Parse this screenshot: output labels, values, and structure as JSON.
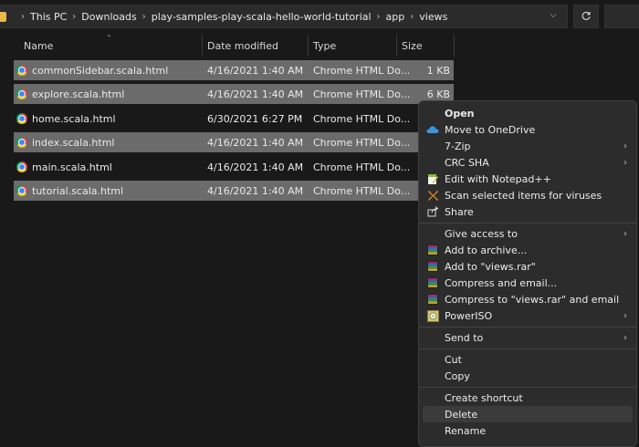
{
  "address_bar": {
    "breadcrumbs": [
      "This PC",
      "Downloads",
      "play-samples-play-scala-hello-world-tutorial",
      "app",
      "views"
    ]
  },
  "columns": {
    "name": "Name",
    "date": "Date modified",
    "type": "Type",
    "size": "Size"
  },
  "files": [
    {
      "name": "commonSidebar.scala.html",
      "date": "4/16/2021 1:40 AM",
      "type": "Chrome HTML Do...",
      "size": "1 KB",
      "selected": true
    },
    {
      "name": "explore.scala.html",
      "date": "4/16/2021 1:40 AM",
      "type": "Chrome HTML Do...",
      "size": "6 KB",
      "selected": true
    },
    {
      "name": "home.scala.html",
      "date": "6/30/2021 6:27 PM",
      "type": "Chrome HTML Do...",
      "size": "",
      "selected": false
    },
    {
      "name": "index.scala.html",
      "date": "4/16/2021 1:40 AM",
      "type": "Chrome HTML Do...",
      "size": "",
      "selected": true
    },
    {
      "name": "main.scala.html",
      "date": "4/16/2021 1:40 AM",
      "type": "Chrome HTML Do...",
      "size": "",
      "selected": false
    },
    {
      "name": "tutorial.scala.html",
      "date": "4/16/2021 1:40 AM",
      "type": "Chrome HTML Do...",
      "size": "",
      "selected": true
    }
  ],
  "context_menu": {
    "open": "Open",
    "move_to_onedrive": "Move to OneDrive",
    "seven_zip": "7-Zip",
    "crc_sha": "CRC SHA",
    "edit_notepad": "Edit with Notepad++",
    "scan_viruses": "Scan selected items for viruses",
    "share": "Share",
    "give_access": "Give access to",
    "add_archive": "Add to archive...",
    "add_views_rar": "Add to \"views.rar\"",
    "compress_email": "Compress and email...",
    "compress_views_email": "Compress to \"views.rar\" and email",
    "poweriso": "PowerISO",
    "send_to": "Send to",
    "cut": "Cut",
    "copy": "Copy",
    "create_shortcut": "Create shortcut",
    "delete": "Delete",
    "rename": "Rename"
  },
  "colors": {
    "background": "#191919",
    "selection": "#6b6b6b",
    "menu_bg": "#2c2c2c",
    "folder_accent": "#e8b948"
  }
}
